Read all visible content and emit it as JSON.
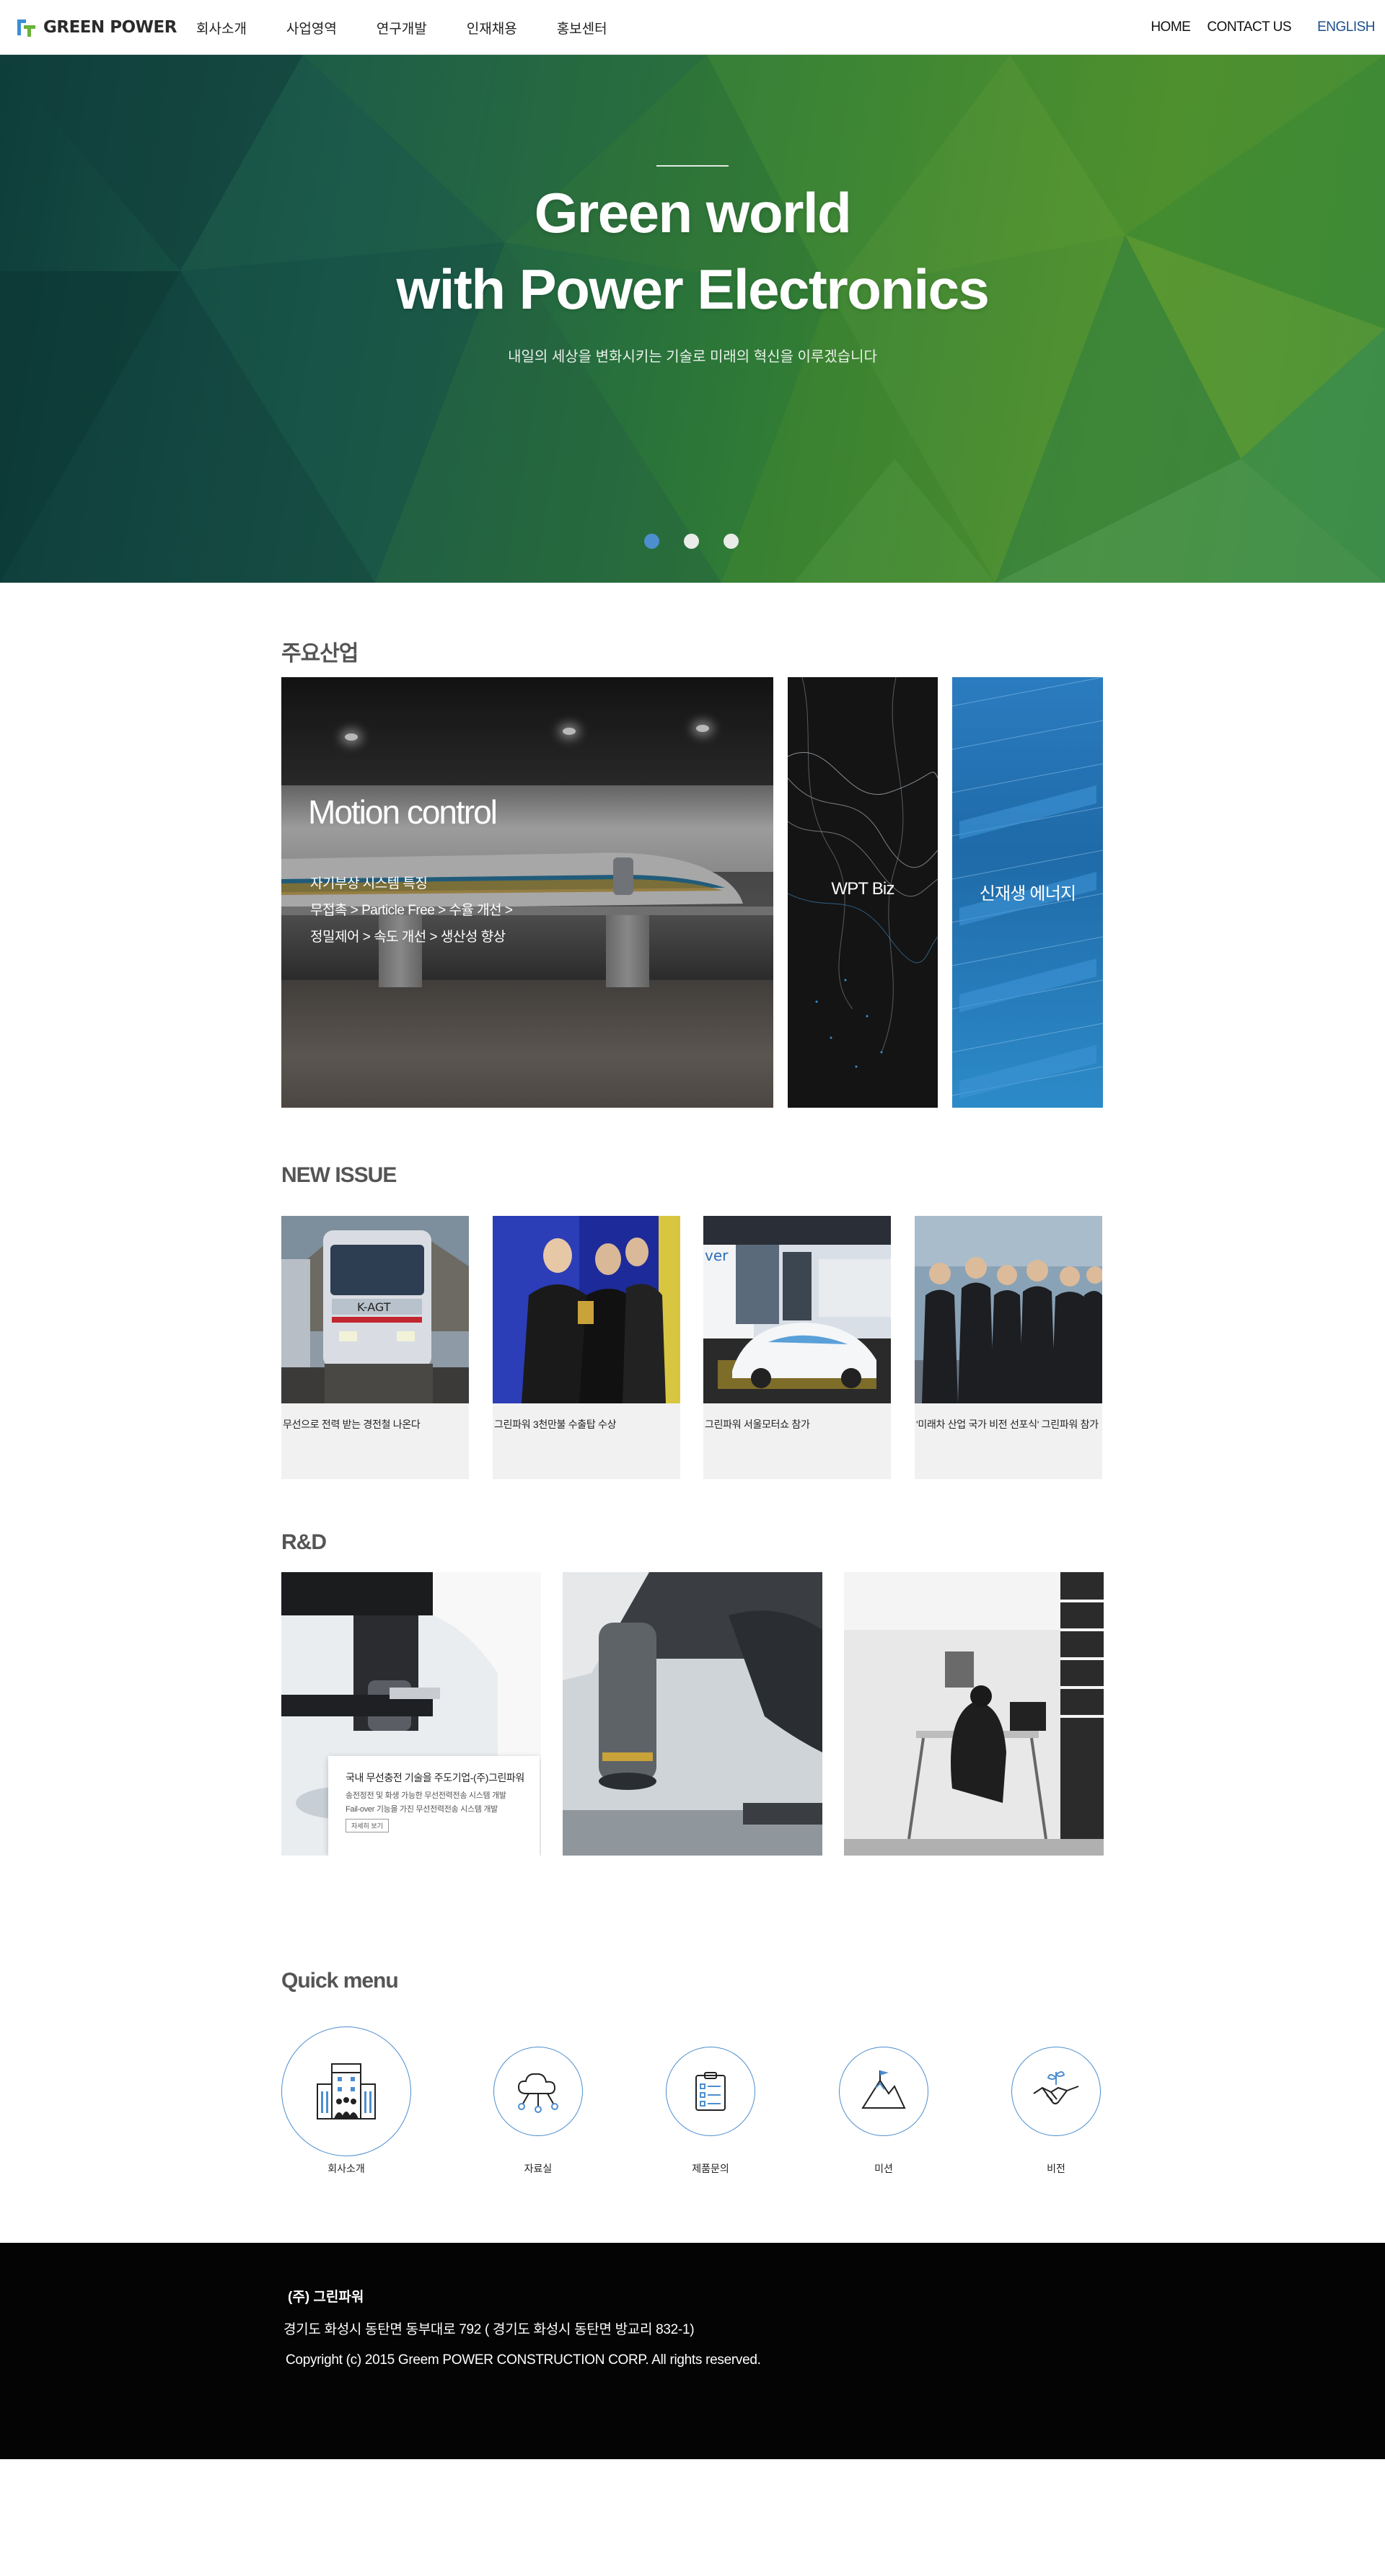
{
  "header": {
    "logo_text": "GREEN POWER",
    "nav": [
      "회사소개",
      "사업영역",
      "연구개발",
      "인재채용",
      "홍보센터"
    ],
    "util": {
      "home": "HOME",
      "contact": "CONTACT US",
      "english": "ENGLISH"
    }
  },
  "hero": {
    "title_line1": "Green world",
    "title_line2": "with Power Electronics",
    "subtitle": "내일의 세상을 변화시키는 기술로 미래의 혁신을 이루겠습니다",
    "slides": 3,
    "active_slide": 1
  },
  "industry": {
    "title": "주요산업",
    "main": {
      "title": "Motion control",
      "lines": [
        "자기부상 시스템 특징",
        "무접촉 > Particle Free > 수율 개선 >",
        "정밀제어 > 속도 개선 > 생산성 향상"
      ]
    },
    "panel_wpt": "WPT Biz",
    "panel_solar": "신재생 에너지"
  },
  "news": {
    "title": "NEW ISSUE",
    "items": [
      {
        "caption": "무선으로 전력 받는 경전철 나온다"
      },
      {
        "caption": "그린파워 3천만불 수출탑 수상"
      },
      {
        "caption": "그린파워 서울모터쇼 참가"
      },
      {
        "caption": "'미래차 산업 국가 비전 선포식' 그린파워 참가"
      }
    ]
  },
  "rd": {
    "title": "R&D",
    "box_title": "국내 무선충전 기술을 주도기업-(주)그린파워",
    "box_line1": "송전정전 및 화생 가능한 무선전력전송 시스템 개발",
    "box_line2": "Fail-over 기능을 가진 무선전력전송 시스템 개발",
    "box_button": "자세히 보기"
  },
  "quick": {
    "title": "Quick menu",
    "items": [
      {
        "label": "회사소개",
        "icon": "building-icon"
      },
      {
        "label": "자료실",
        "icon": "cloud-network-icon"
      },
      {
        "label": "제품문의",
        "icon": "clipboard-checklist-icon"
      },
      {
        "label": "미션",
        "icon": "mountain-flag-icon"
      },
      {
        "label": "비전",
        "icon": "handshake-plant-icon"
      }
    ]
  },
  "footer": {
    "company": "(주) 그린파워",
    "address": "경기도 화성시 동탄면 동부대로 792 ( 경기도 화성시 동탄면 방교리 832-1)",
    "copyright": "Copyright (c) 2015 Greem POWER CONSTRUCTION CORP. All rights reserved."
  },
  "colors": {
    "accent_blue": "#4c8fcf",
    "hero_green": "#2e7a36",
    "footer_bg": "#040404"
  }
}
